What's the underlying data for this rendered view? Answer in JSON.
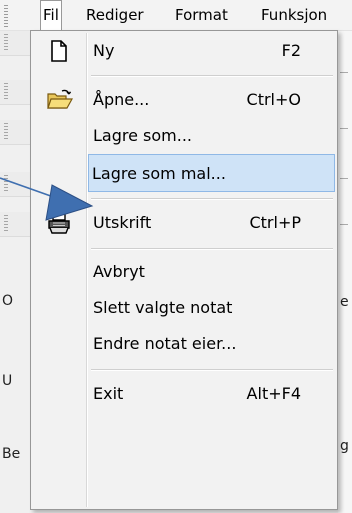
{
  "menubar": {
    "items": [
      "Fil",
      "Rediger",
      "Format",
      "Funksjon"
    ],
    "active_index": 0
  },
  "background": {
    "left_labels": [
      "O",
      "U",
      "Be"
    ],
    "right_fragments": [
      "e",
      "g"
    ]
  },
  "file_menu": {
    "items": [
      {
        "label": "Ny",
        "shortcut": "F2",
        "icon": "new-document-icon"
      },
      {
        "label": "Åpne...",
        "shortcut": "Ctrl+O",
        "icon": "open-folder-icon"
      },
      {
        "label": "Lagre som...",
        "shortcut": ""
      },
      {
        "label": "Lagre som mal...",
        "shortcut": "",
        "highlighted": true
      },
      {
        "label": "Utskrift",
        "shortcut": "Ctrl+P",
        "icon": "printer-icon"
      },
      {
        "label": "Avbryt",
        "shortcut": ""
      },
      {
        "label": "Slett valgte notat",
        "shortcut": ""
      },
      {
        "label": "Endre notat eier...",
        "shortcut": ""
      },
      {
        "label": "Exit",
        "shortcut": "Alt+F4"
      }
    ]
  },
  "colors": {
    "highlight_fill": "#cfe3f7",
    "highlight_border": "#8fb8e6",
    "arrow": "#3f6fb0"
  }
}
